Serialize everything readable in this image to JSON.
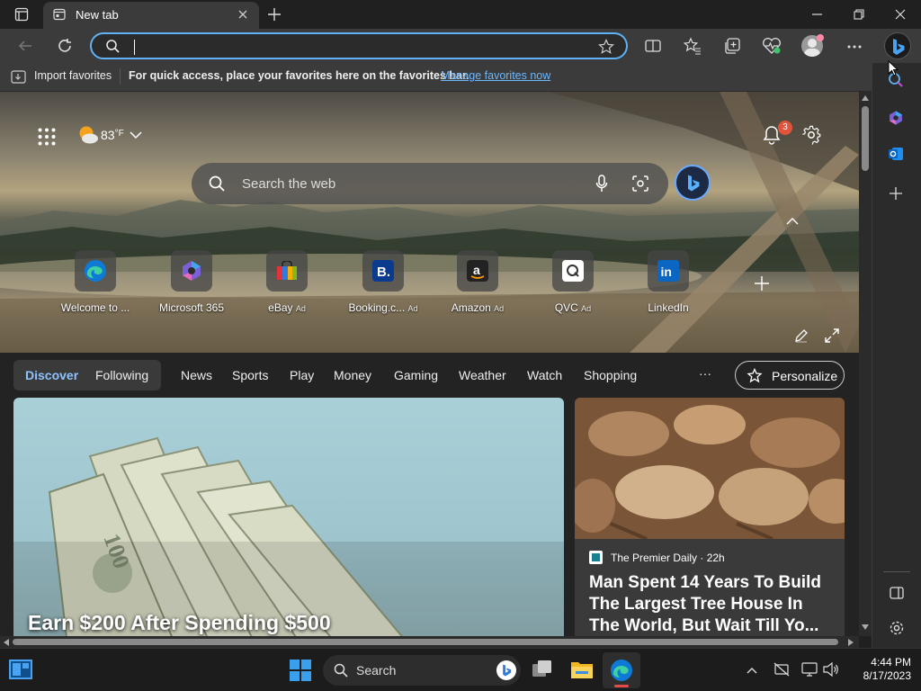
{
  "window": {
    "tab_title": "New tab"
  },
  "address": {
    "value": ""
  },
  "favbar": {
    "import_label": "Import favorites",
    "message": "For quick access, place your favorites here on the favorites bar.",
    "manage_link": "Manage favorites now"
  },
  "hero": {
    "weather": "83",
    "weather_unit": "°F",
    "notification_count": "3",
    "search_placeholder": "Search the web"
  },
  "tiles": [
    {
      "label": "Welcome to ...",
      "ad": "",
      "icon": "edge-icon"
    },
    {
      "label": "Microsoft 365",
      "ad": "",
      "icon": "microsoft365-icon"
    },
    {
      "label": "eBay",
      "ad": "Ad",
      "icon": "ebay-icon"
    },
    {
      "label": "Booking.c...",
      "ad": "Ad",
      "icon": "booking-icon"
    },
    {
      "label": "Amazon",
      "ad": "Ad",
      "icon": "amazon-icon"
    },
    {
      "label": "QVC",
      "ad": "Ad",
      "icon": "qvc-icon"
    },
    {
      "label": "LinkedIn",
      "ad": "",
      "icon": "linkedin-icon"
    }
  ],
  "feed_nav": {
    "discover": "Discover",
    "following": "Following",
    "items": [
      "News",
      "Sports",
      "Play",
      "Money",
      "Gaming",
      "Weather",
      "Watch",
      "Shopping"
    ],
    "more": "···",
    "personalize": "Personalize"
  },
  "cards": {
    "main_headline": "Earn $200 After Spending $500",
    "side_source": "The Premier Daily",
    "side_age": "22h",
    "side_separator": " · ",
    "side_headline": "Man Spent 14 Years To Build The Largest Tree House In The World, But Wait Till Yo..."
  },
  "taskbar": {
    "search_label": "Search",
    "time": "4:44 PM",
    "date": "8/17/2023"
  },
  "colors": {
    "accent": "#5fb2f5",
    "link": "#6cb8ff",
    "badge": "#e0543c",
    "discover_text": "#8fc3ff"
  }
}
